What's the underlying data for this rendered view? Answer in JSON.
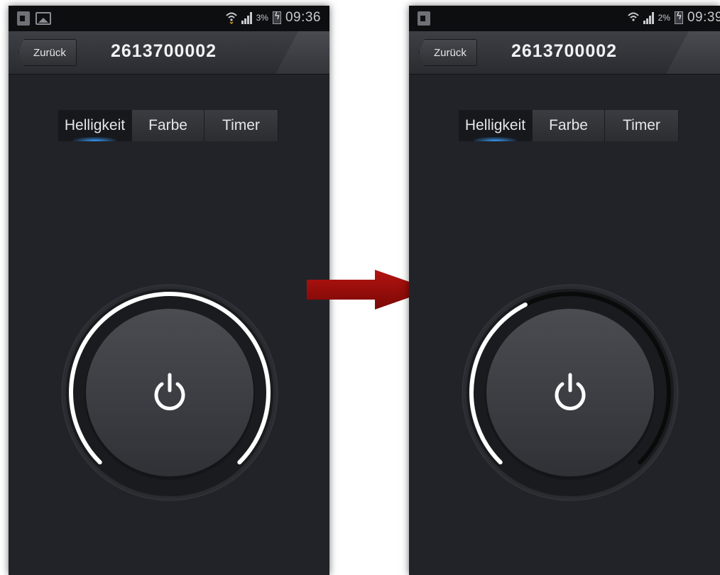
{
  "screens": [
    {
      "status": {
        "battery": "3%",
        "time": "09:36"
      },
      "back_label": "Zurück",
      "title": "2613700002",
      "tabs": [
        "Helligkeit",
        "Farbe",
        "Timer"
      ],
      "active_tab": "Helligkeit",
      "brightness_level": 1.0
    },
    {
      "status": {
        "battery": "2%",
        "time": "09:39"
      },
      "back_label": "Zurück",
      "title": "2613700002",
      "tabs": [
        "Helligkeit",
        "Farbe",
        "Timer"
      ],
      "active_tab": "Helligkeit",
      "brightness_level": 0.4
    }
  ],
  "colors": {
    "background": "#222328",
    "accent_tab_glow": "#3aa0ff",
    "arc_active": "#ffffff",
    "arc_inactive": "#0a0a0b",
    "arrow": "#a00e0b"
  },
  "icons": [
    "sim-card-icon",
    "gallery-icon",
    "wifi-icon",
    "signal-icon",
    "battery-charging-icon",
    "power-icon",
    "arrow-right-icon"
  ]
}
